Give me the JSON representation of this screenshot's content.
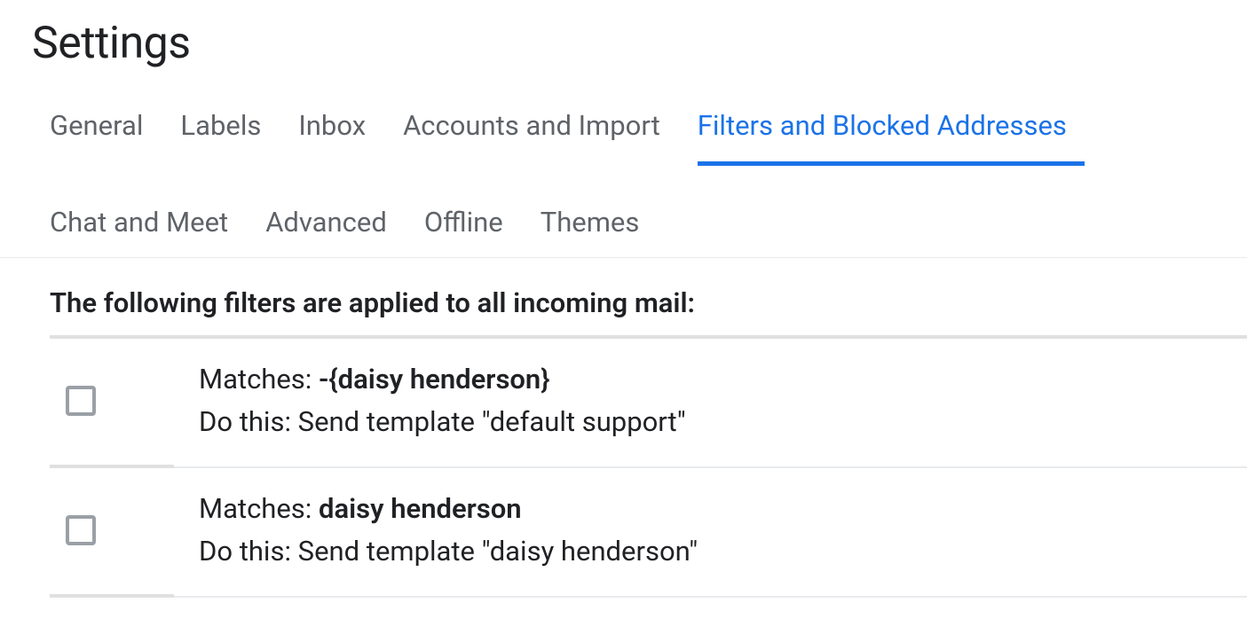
{
  "page_title": "Settings",
  "tabs": [
    {
      "label": "General",
      "active": false
    },
    {
      "label": "Labels",
      "active": false
    },
    {
      "label": "Inbox",
      "active": false
    },
    {
      "label": "Accounts and Import",
      "active": false
    },
    {
      "label": "Filters and Blocked Addresses",
      "active": true
    },
    {
      "label": "Chat and Meet",
      "active": false
    },
    {
      "label": "Advanced",
      "active": false
    },
    {
      "label": "Offline",
      "active": false
    },
    {
      "label": "Themes",
      "active": false
    }
  ],
  "intro": "The following filters are applied to all incoming mail:",
  "matches_label": "Matches: ",
  "action_label": "Do this: ",
  "filters": [
    {
      "matches": "-{daisy henderson}",
      "action": "Send template \"default support\""
    },
    {
      "matches": "daisy henderson",
      "action": "Send template \"daisy henderson\""
    }
  ]
}
